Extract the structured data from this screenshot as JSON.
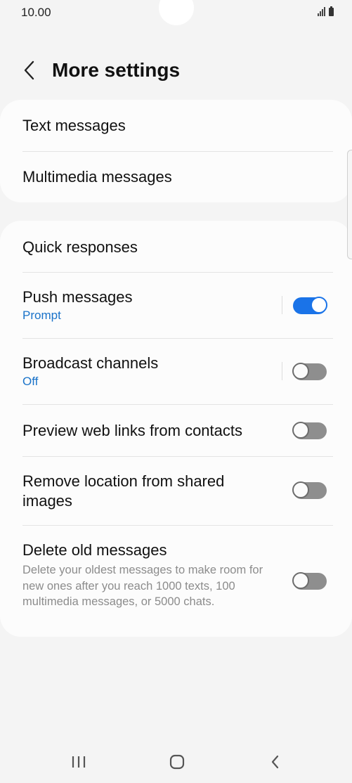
{
  "status_bar": {
    "time": "10.00",
    "icons": [
      "signal-icon",
      "battery-icon"
    ]
  },
  "header": {
    "title": "More settings",
    "back_icon": "chevron-left-icon"
  },
  "group1": [
    {
      "title": "Text messages"
    },
    {
      "title": "Multimedia messages"
    }
  ],
  "group2": {
    "quick_responses": {
      "title": "Quick responses"
    },
    "push_messages": {
      "title": "Push messages",
      "subtitle": "Prompt",
      "enabled": true
    },
    "broadcast_channels": {
      "title": "Broadcast channels",
      "subtitle": "Off",
      "enabled": false
    },
    "preview_links": {
      "title": "Preview web links from contacts",
      "enabled": false
    },
    "remove_location": {
      "title": "Remove location from shared images",
      "enabled": false
    },
    "delete_old": {
      "title": "Delete old messages",
      "description": "Delete your oldest messages to make room for new ones after you reach 1000 texts, 100 multimedia messages, or 5000 chats.",
      "enabled": false
    }
  },
  "nav_bar": {
    "icons": [
      "recent-apps-icon",
      "home-icon",
      "back-icon"
    ]
  },
  "colors": {
    "accent": "#1a73e8",
    "subtitle": "#1a73c9",
    "background": "#f4f4f4",
    "card": "#fcfcfc"
  }
}
